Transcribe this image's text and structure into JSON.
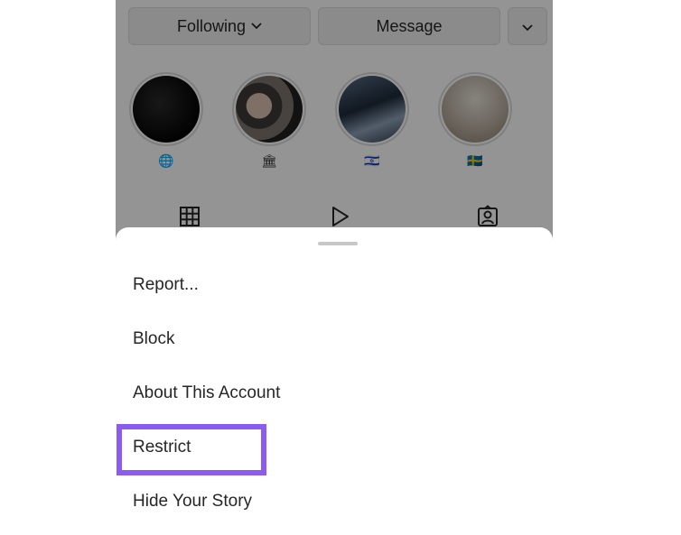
{
  "profile": {
    "buttons": {
      "following_label": "Following",
      "message_label": "Message"
    },
    "highlights": [
      {
        "emoji": "🌐"
      },
      {
        "emoji": "🏛"
      },
      {
        "emoji": "🇮🇱"
      },
      {
        "emoji": "🇸🇪"
      }
    ]
  },
  "sheet": {
    "items": [
      {
        "label": "Report..."
      },
      {
        "label": "Block"
      },
      {
        "label": "About This Account"
      },
      {
        "label": "Restrict"
      },
      {
        "label": "Hide Your Story"
      }
    ]
  },
  "colors": {
    "highlight_box": "#8c5cf0",
    "overlay": "rgba(0,0,0,0.42)",
    "text": "#262626"
  }
}
